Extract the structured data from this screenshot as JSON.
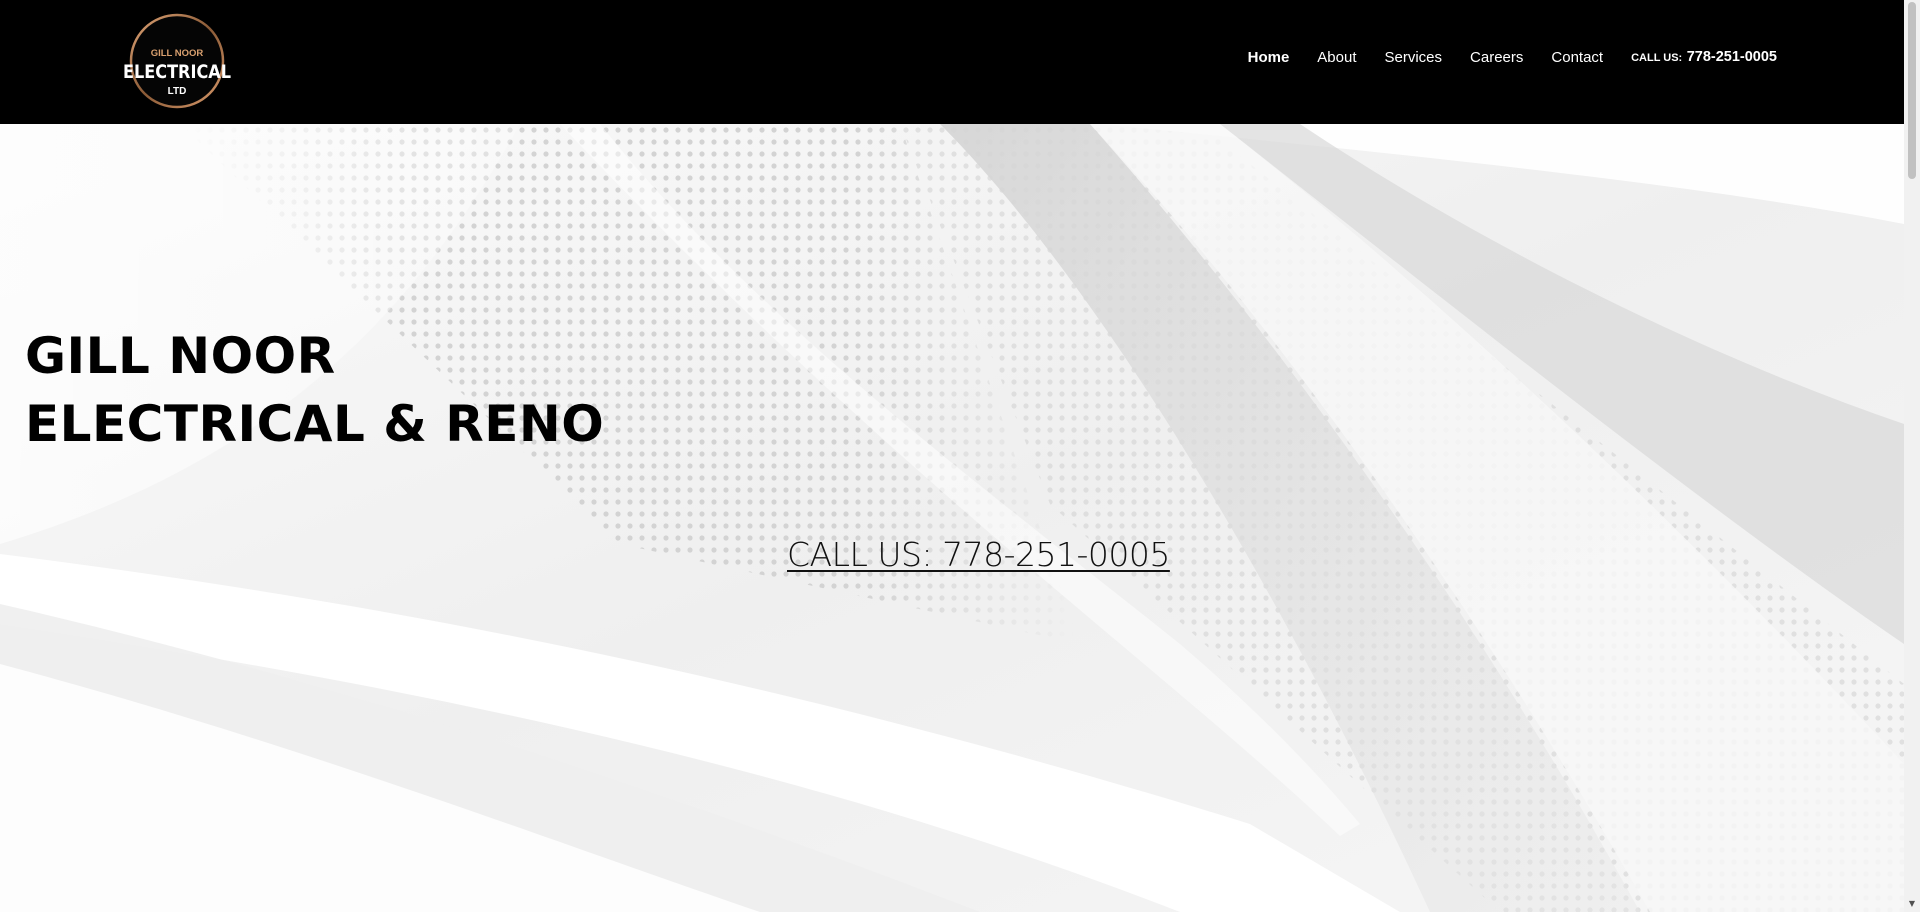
{
  "brand": {
    "logo_top": "GILL NOOR",
    "logo_main": "ELECTRICAL",
    "logo_bottom": "LTD",
    "ring_color": "#c8895a"
  },
  "nav": {
    "items": [
      {
        "label": "Home",
        "active": true
      },
      {
        "label": "About",
        "active": false
      },
      {
        "label": "Services",
        "active": false
      },
      {
        "label": "Careers",
        "active": false
      },
      {
        "label": "Contact",
        "active": false
      }
    ],
    "call_prefix": "CALL US:",
    "call_number": "778-251-0005"
  },
  "hero": {
    "title_line1": "GILL NOOR",
    "title_line2": "ELECTRICAL & RENO",
    "call_link": "CALL US: 778-251-0005"
  },
  "colors": {
    "header_bg": "#000000",
    "hero_bg": "#f3f3f3",
    "text": "#000000"
  },
  "scrollbar": {
    "arrow_icon": "chevron-down-icon"
  }
}
